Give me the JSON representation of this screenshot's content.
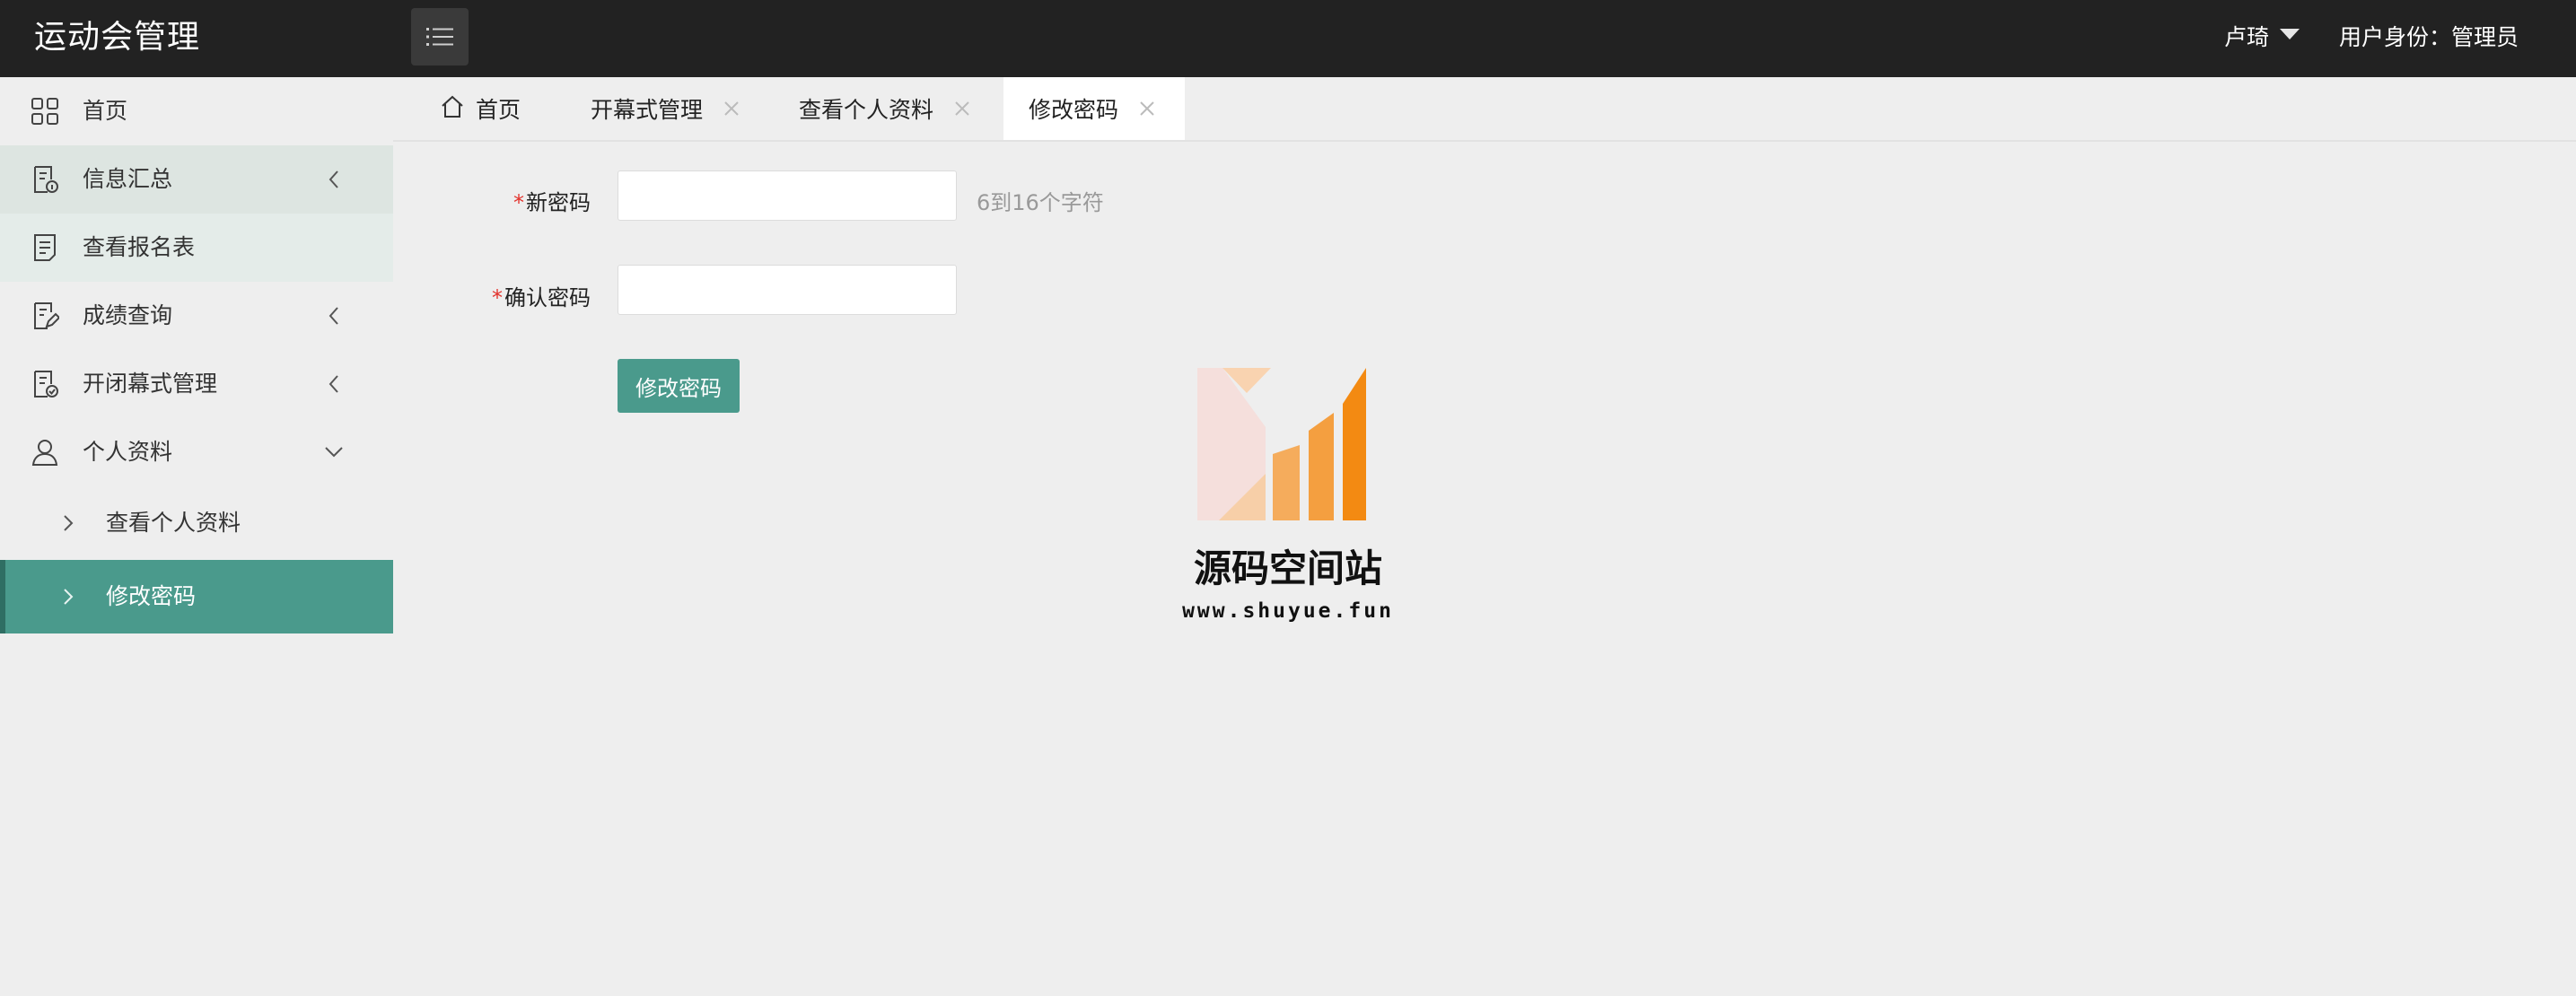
{
  "header": {
    "app_title": "运动会管理",
    "user_name": "卢琦",
    "user_role": "用户身份：管理员"
  },
  "sidebar": {
    "items": [
      {
        "label": "首页",
        "icon": "grid-icon"
      },
      {
        "label": "信息汇总",
        "icon": "document-info-icon"
      },
      {
        "label": "查看报名表",
        "icon": "document-list-icon"
      },
      {
        "label": "成绩查询",
        "icon": "document-edit-icon"
      },
      {
        "label": "开闭幕式管理",
        "icon": "document-check-icon"
      },
      {
        "label": "个人资料",
        "icon": "user-icon"
      }
    ],
    "sub_items": [
      {
        "label": "查看个人资料"
      },
      {
        "label": "修改密码",
        "active": true
      }
    ]
  },
  "tabs": [
    {
      "label": "首页",
      "icon": "home-icon"
    },
    {
      "label": "开幕式管理",
      "closable": true
    },
    {
      "label": "查看个人资料",
      "closable": true
    },
    {
      "label": "修改密码",
      "closable": true,
      "active": true
    }
  ],
  "form": {
    "new_password_label": "新密码",
    "new_password_value": "",
    "new_password_hint": "6到16个字符",
    "confirm_password_label": "确认密码",
    "confirm_password_value": "",
    "required_mark": "*",
    "submit_label": "修改密码"
  },
  "watermark": {
    "name": "源码空间站",
    "url": "www.shuyue.fun"
  },
  "colors": {
    "header_bg": "#222222",
    "accent": "#4a9a8c",
    "page_bg": "#eeeeee",
    "required": "#e2312b"
  }
}
